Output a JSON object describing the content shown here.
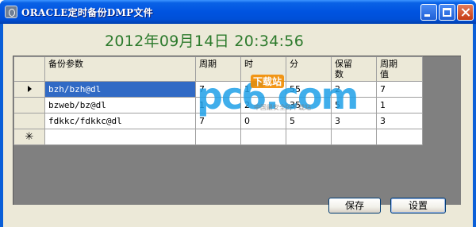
{
  "window": {
    "title": "ORACLE定时备份DMP文件"
  },
  "datetime": "2012年09月14日  20:34:56",
  "grid": {
    "columns": [
      "备份参数",
      "周期",
      "时",
      "分",
      "保留数",
      "周期值"
    ],
    "rows": [
      {
        "indicator": "current",
        "param": "bzh/bzh@dl",
        "period": "7",
        "hour": "1",
        "minute": "55",
        "keep": "2",
        "period_value": "7"
      },
      {
        "indicator": "",
        "param": "bzweb/bz@dl",
        "period": "1",
        "hour": "2",
        "minute": "35",
        "keep": "5",
        "period_value": "1"
      },
      {
        "indicator": "",
        "param": "fdkkc/fdkkc@dl",
        "period": "7",
        "hour": "0",
        "minute": "5",
        "keep": "3",
        "period_value": "3"
      }
    ],
    "new_row_symbol": "✳"
  },
  "buttons": {
    "save": "保存",
    "settings": "设置"
  },
  "watermark": {
    "logo": "pc6.com",
    "tag": "下载站",
    "tagline": "中国最安全的下载站"
  },
  "colors": {
    "titlebar": "#0053e0",
    "datetime_text": "#2c7a2c",
    "selection": "#316ac5",
    "grid_background": "#808080"
  }
}
